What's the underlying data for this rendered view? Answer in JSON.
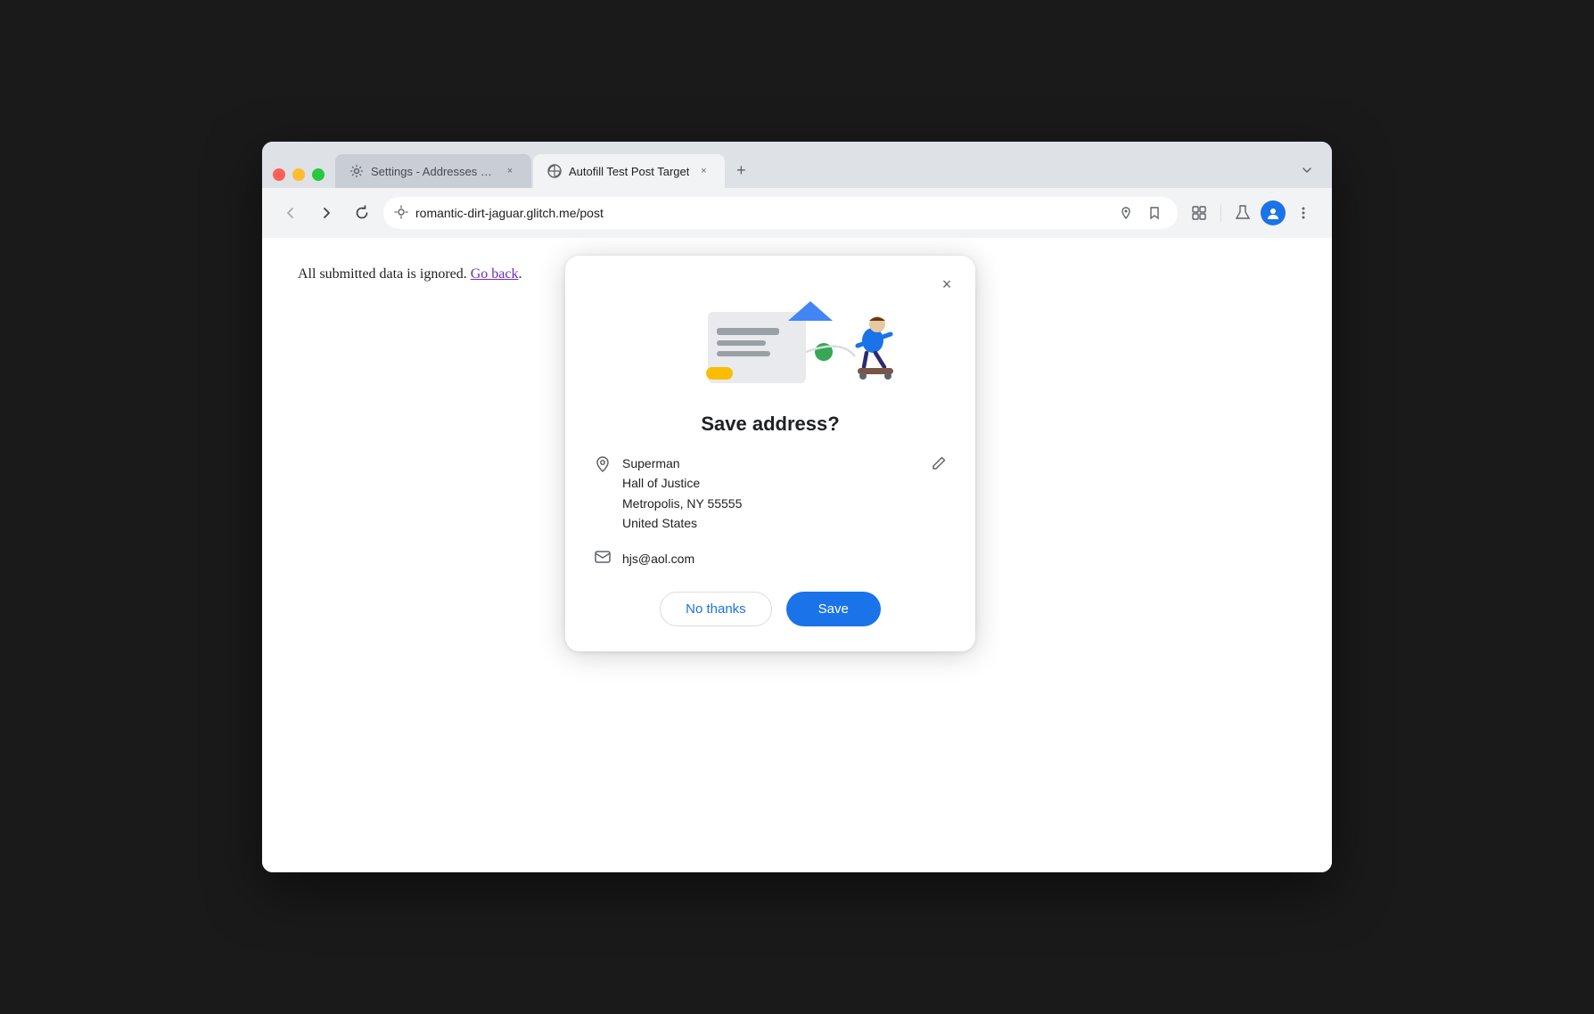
{
  "browser": {
    "tabs": [
      {
        "id": "settings-tab",
        "label": "Settings - Addresses and mo",
        "icon": "gear",
        "active": false
      },
      {
        "id": "autofill-tab",
        "label": "Autofill Test Post Target",
        "icon": "globe",
        "active": true
      }
    ],
    "new_tab_label": "+",
    "url": "romantic-dirt-jaguar.glitch.me/post",
    "nav": {
      "back_label": "←",
      "forward_label": "→",
      "refresh_label": "↺"
    }
  },
  "page": {
    "content_text": "All submitted data is ignored.",
    "go_back_label": "Go back",
    "period": "."
  },
  "popup": {
    "title": "Save address?",
    "close_label": "×",
    "address": {
      "name": "Superman",
      "line1": "Hall of Justice",
      "line2": "Metropolis, NY 55555",
      "country": "United States"
    },
    "email": "hjs@aol.com",
    "no_thanks_label": "No thanks",
    "save_label": "Save"
  }
}
